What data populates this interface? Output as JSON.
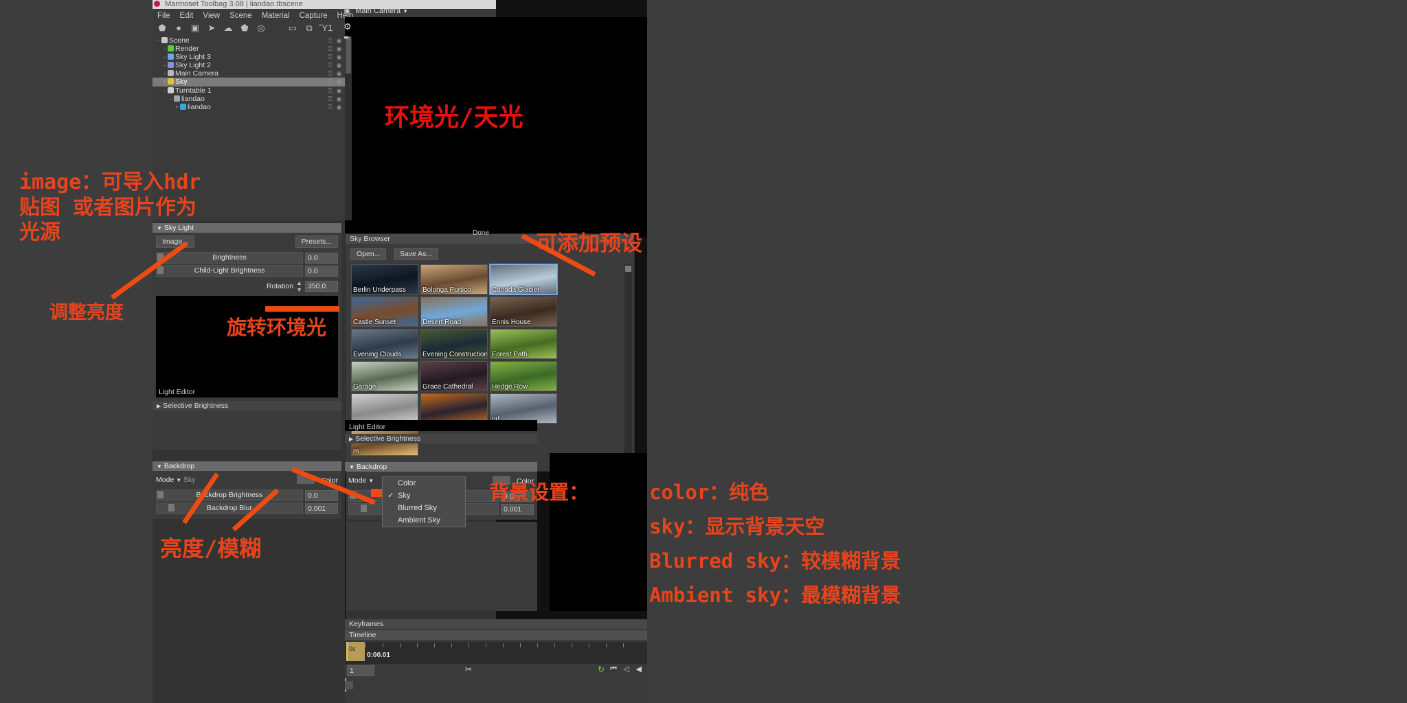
{
  "window": {
    "title": "Marmoset Toolbag 3.08  |  liandao.tbscene",
    "menus": [
      "File",
      "Edit",
      "View",
      "Scene",
      "Material",
      "Capture",
      "Help"
    ],
    "toolbar_icons": [
      "mesh-icon",
      "light-icon",
      "camera-icon",
      "turntable-icon",
      "sky-icon",
      "object-icon",
      "render-icon",
      "folder-icon",
      "duplicate-icon",
      "trash-icon"
    ],
    "header_icons": [
      "camera-header-icon",
      "gear-icon",
      "brush-icon"
    ]
  },
  "scene_tree": {
    "items": [
      {
        "label": "Scene",
        "depth": 0,
        "toggle": "-",
        "color": "#c9c9c9",
        "selected": false
      },
      {
        "label": "Render",
        "depth": 1,
        "toggle": "-",
        "color": "#5ecb3f",
        "selected": false
      },
      {
        "label": "Sky Light 3",
        "depth": 1,
        "toggle": "-",
        "color": "#6fa8dc",
        "selected": false
      },
      {
        "label": "Sky Light 2",
        "depth": 1,
        "toggle": "-",
        "color": "#8f8fd8",
        "selected": false
      },
      {
        "label": "Main Camera",
        "depth": 1,
        "toggle": "-",
        "color": "#b9b9b9",
        "selected": false
      },
      {
        "label": "Sky",
        "depth": 1,
        "toggle": "+",
        "color": "#e0c33a",
        "selected": true
      },
      {
        "label": "Turntable 1",
        "depth": 1,
        "toggle": "-",
        "color": "#cfcfcf",
        "selected": false
      },
      {
        "label": "liandao",
        "depth": 2,
        "toggle": "-",
        "color": "#9aa7b5",
        "selected": false
      },
      {
        "label": "liandao",
        "depth": 3,
        "toggle": "+",
        "color": "#3aa7d8",
        "selected": false
      }
    ],
    "row_icons": [
      "lock-icon",
      "eye-icon"
    ]
  },
  "viewport": {
    "camera_label": "Main Camera",
    "camera_dropdown_arrow": "chevron-down-icon"
  },
  "sky_light_panel": {
    "title": "Sky Light",
    "collapse_arrow": "triangle-down-icon",
    "image_button": "Image...",
    "presets_button": "Presets...",
    "sliders": [
      {
        "label": "Brightness",
        "value": "0.0",
        "fill": 0.03
      },
      {
        "label": "Child-Light Brightness",
        "value": "0.0",
        "fill": 0.03
      }
    ],
    "rotation_label": "Rotation",
    "rotation_value": "350.0",
    "preview_caption": "Light Editor",
    "selective_brightness": "Selective Brightness"
  },
  "backdrop_panel": {
    "title": "Backdrop",
    "mode_label": "Mode",
    "mode_value": "Sky",
    "color_label": "Color",
    "sliders": [
      {
        "label": "Backdrop Brightness",
        "value": "0.0",
        "fill": 0.03
      },
      {
        "label": "Backdrop Blur",
        "value": "0.001",
        "fill": 0.16
      }
    ]
  },
  "mode_menu": {
    "items": [
      {
        "label": "Color",
        "checked": false
      },
      {
        "label": "Sky",
        "checked": true
      },
      {
        "label": "Blurred Sky",
        "checked": false
      },
      {
        "label": "Ambient Sky",
        "checked": false
      }
    ],
    "check_glyph": "check-icon"
  },
  "sky_browser": {
    "title": "Sky Browser",
    "open_button": "Open...",
    "save_as_button": "Save As...",
    "done_button": "Done",
    "thumbnails": [
      {
        "label": "Berlin Underpass",
        "c1": "#0d1620",
        "c2": "#2a3a48",
        "selected": false
      },
      {
        "label": "Bolonga Portico",
        "c1": "#6b4a32",
        "c2": "#c8a878",
        "selected": false
      },
      {
        "label": "Canada Glacier",
        "c1": "#b8cbd8",
        "c2": "#5e6f7a",
        "selected": true
      },
      {
        "label": "Castle Sunset",
        "c1": "#7b4a2a",
        "c2": "#3b6a9a",
        "selected": false
      },
      {
        "label": "Desert Road",
        "c1": "#6fa8d8",
        "c2": "#8a7158",
        "selected": false
      },
      {
        "label": "Ennis House",
        "c1": "#3a2a20",
        "c2": "#7a6450",
        "selected": false
      },
      {
        "label": "Evening Clouds",
        "c1": "#2e3b4a",
        "c2": "#6a7a88",
        "selected": false
      },
      {
        "label": "Evening Construction",
        "c1": "#1b2a38",
        "c2": "#4a5a30",
        "selected": false
      },
      {
        "label": "Forest Path",
        "c1": "#466b22",
        "c2": "#9cc05a",
        "selected": false
      },
      {
        "label": "Garage",
        "c1": "#5a6a52",
        "c2": "#c4d0c0",
        "selected": false
      },
      {
        "label": "Grace Cathedral",
        "c1": "#241a20",
        "c2": "#5a4048",
        "selected": false
      },
      {
        "label": "Hedge Row",
        "c1": "#3a6a24",
        "c2": "#86b048",
        "selected": false
      },
      {
        "label": "",
        "c1": "#8a8a8a",
        "c2": "#d0d0d0",
        "selected": false
      },
      {
        "label": "",
        "c1": "#2a2230",
        "c2": "#c06a20",
        "selected": false
      },
      {
        "label": "nd",
        "c1": "#56606e",
        "c2": "#aeb8c4",
        "selected": false
      },
      {
        "label": "m",
        "c1": "#6a4a2a",
        "c2": "#e8c070",
        "selected": false
      }
    ]
  },
  "light_editor": {
    "caption": "Light Editor",
    "selective_brightness": "Selective Brightness"
  },
  "timeline": {
    "keyframes_title": "Keyframes",
    "timeline_title": "Timeline",
    "time_marker": "0s",
    "time_code": "0:00.01",
    "frame_value": "1",
    "controls": [
      "cut-icon",
      "loop-icon",
      "skip-start-icon",
      "step-back-icon",
      "play-back-icon"
    ]
  },
  "annotations": {
    "viewport_label": "环境光/天光",
    "image_note": "image：可导入hdr\n贴图 或者图片作为\n光源",
    "brightness_note": "调整亮度",
    "rotation_note": "旋转环境光",
    "presets_note": "可添加预设",
    "blur_note": "亮度/模糊",
    "backdrop_note": "背景设置：",
    "mode_notes": [
      "color：纯色",
      "sky：显示背景天空",
      "Blurred sky：较模糊背景",
      "Ambient sky：最模糊背景"
    ]
  },
  "colors": {
    "annotation_orange": "#e8441c",
    "annotation_red": "#e8110c",
    "selection_blue": "#8ab4e8",
    "panel_bg": "#3b3b3b",
    "page_bg": "#3d3d3d"
  }
}
